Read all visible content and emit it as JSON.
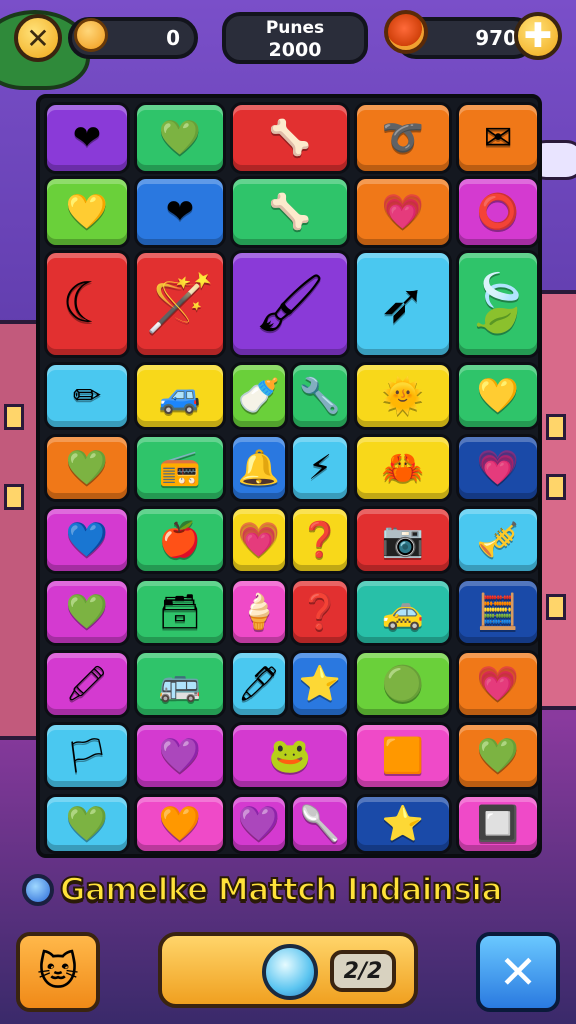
{
  "header": {
    "close_glyph": "✕",
    "coins": "0",
    "score_label": "Punes",
    "score_value": "2000",
    "gems": "970",
    "plus_glyph": "✚"
  },
  "colors": {
    "purple": "#8a3ad8",
    "green": "#2fc46a",
    "red": "#e23030",
    "orange": "#f07818",
    "blue": "#2a78e0",
    "magenta": "#d43ad0",
    "yellow": "#f8d81a",
    "cyan": "#4ac8f0",
    "teal": "#28c0a8",
    "lime": "#6ad03a",
    "pink": "#ef4ac8",
    "darkblue": "#1a4aa8"
  },
  "board": {
    "tiles": [
      {
        "icon": "heart-icon",
        "glyph": "❤",
        "color": "purple"
      },
      {
        "icon": "heart-icon",
        "glyph": "💚",
        "color": "green"
      },
      {
        "icon": "bone-icon",
        "glyph": "🦴",
        "color": "red"
      },
      {
        "icon": "hook-icon",
        "glyph": "➰",
        "color": "orange"
      },
      {
        "icon": "envelope-icon",
        "glyph": "✉",
        "color": "orange"
      },
      {
        "icon": "heart-icon",
        "glyph": "💛",
        "color": "lime"
      },
      {
        "icon": "heart-icon",
        "glyph": "❤",
        "color": "blue"
      },
      {
        "icon": "bone-icon",
        "glyph": "🦴",
        "color": "green"
      },
      {
        "icon": "heart-icon",
        "glyph": "💗",
        "color": "orange"
      },
      {
        "icon": "ring-icon",
        "glyph": "⭕",
        "color": "magenta"
      },
      {
        "icon": "crescent-icon",
        "glyph": "☾",
        "color": "red",
        "big": true
      },
      {
        "icon": "wand-icon",
        "glyph": "🪄",
        "color": "red",
        "big": true
      },
      {
        "icon": "paintbrush-icon",
        "glyph": "🖌",
        "color": "purple",
        "big": true
      },
      {
        "icon": "arrow-icon",
        "glyph": "➶",
        "color": "cyan",
        "big": true
      },
      {
        "icon": "leaf-icon",
        "glyph": "🍃",
        "color": "green",
        "big": true
      },
      {
        "icon": "pencil-icon",
        "glyph": "✏",
        "color": "cyan"
      },
      {
        "icon": "car-icon",
        "glyph": "🚙",
        "color": "yellow"
      },
      {
        "icon": "bottle-icon",
        "glyph": "🍼",
        "color": "lime"
      },
      {
        "icon": "key-icon",
        "glyph": "🔧",
        "color": "green"
      },
      {
        "icon": "sun-face-icon",
        "glyph": "🌞",
        "color": "yellow"
      },
      {
        "icon": "heart-icon",
        "glyph": "💛",
        "color": "green"
      },
      {
        "icon": "heart-icon",
        "glyph": "💚",
        "color": "orange"
      },
      {
        "icon": "radio-icon",
        "glyph": "📻",
        "color": "green"
      },
      {
        "icon": "bell-icon",
        "glyph": "🔔",
        "color": "blue"
      },
      {
        "icon": "bolt-icon",
        "glyph": "⚡",
        "color": "cyan"
      },
      {
        "icon": "crab-icon",
        "glyph": "🦀",
        "color": "yellow"
      },
      {
        "icon": "heart-icon",
        "glyph": "💗",
        "color": "darkblue"
      },
      {
        "icon": "heart-icon",
        "glyph": "💙",
        "color": "magenta"
      },
      {
        "icon": "apple-icon",
        "glyph": "🍎",
        "color": "green"
      },
      {
        "icon": "heart-icon",
        "glyph": "💗",
        "color": "yellow"
      },
      {
        "icon": "hook-icon",
        "glyph": "❓",
        "color": "yellow"
      },
      {
        "icon": "camera-icon",
        "glyph": "📷",
        "color": "red"
      },
      {
        "icon": "trumpet-icon",
        "glyph": "🎺",
        "color": "cyan"
      },
      {
        "icon": "heart-icon",
        "glyph": "💚",
        "color": "magenta"
      },
      {
        "icon": "box-icon",
        "glyph": "🗃",
        "color": "green"
      },
      {
        "icon": "cone-icon",
        "glyph": "🍦",
        "color": "pink"
      },
      {
        "icon": "question-icon",
        "glyph": "❓",
        "color": "red"
      },
      {
        "icon": "car-icon",
        "glyph": "🚕",
        "color": "teal"
      },
      {
        "icon": "box-icon",
        "glyph": "🧮",
        "color": "darkblue"
      },
      {
        "icon": "brush-icon",
        "glyph": "🖍",
        "color": "magenta"
      },
      {
        "icon": "bus-icon",
        "glyph": "🚌",
        "color": "green"
      },
      {
        "icon": "crayon-icon",
        "glyph": "🖊",
        "color": "cyan"
      },
      {
        "icon": "star-icon",
        "glyph": "⭐",
        "color": "blue"
      },
      {
        "icon": "blob-icon",
        "glyph": "🟢",
        "color": "lime"
      },
      {
        "icon": "heart-icon",
        "glyph": "💗",
        "color": "orange"
      },
      {
        "icon": "flag-icon",
        "glyph": "🏳",
        "color": "cyan"
      },
      {
        "icon": "heart-icon",
        "glyph": "💜",
        "color": "magenta"
      },
      {
        "icon": "frog-icon",
        "glyph": "🐸",
        "color": "magenta"
      },
      {
        "icon": "square-icon",
        "glyph": "🟧",
        "color": "pink"
      },
      {
        "icon": "heart-icon",
        "glyph": "💚",
        "color": "orange"
      },
      {
        "icon": "heart-icon",
        "glyph": "💚",
        "color": "cyan"
      },
      {
        "icon": "heart-icon",
        "glyph": "🧡",
        "color": "pink"
      },
      {
        "icon": "heart-icon",
        "glyph": "💜",
        "color": "magenta"
      },
      {
        "icon": "funnel-icon",
        "glyph": "🥄",
        "color": "magenta"
      },
      {
        "icon": "star-icon",
        "glyph": "⭐",
        "color": "darkblue"
      },
      {
        "icon": "grid-icon",
        "glyph": "🔲",
        "color": "pink"
      }
    ]
  },
  "footer": {
    "title": "Gamelke Mattch  Indainsia",
    "moves": "2/2",
    "left_glyph": "🐱",
    "right_glyph": "✕"
  }
}
